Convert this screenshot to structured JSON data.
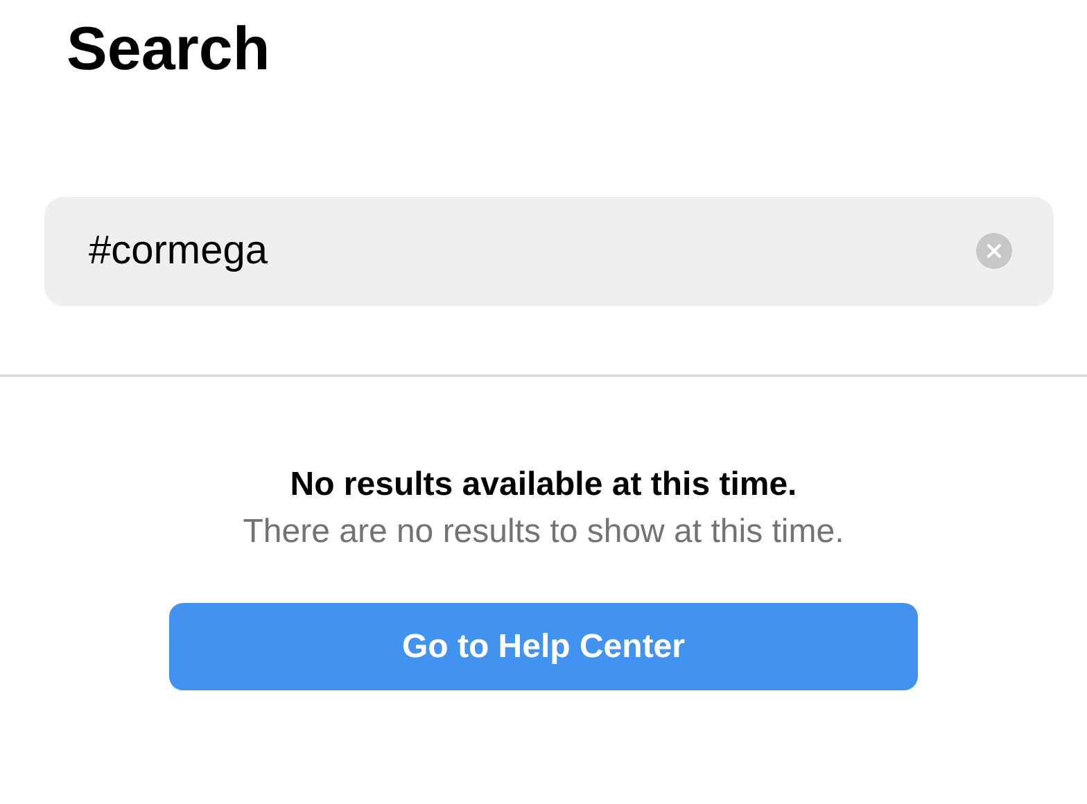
{
  "title": "Search",
  "search": {
    "value": "#cormega"
  },
  "empty_state": {
    "heading": "No results available at this time.",
    "message": "There are no results to show at this time."
  },
  "button": {
    "label": "Go to Help Center"
  }
}
